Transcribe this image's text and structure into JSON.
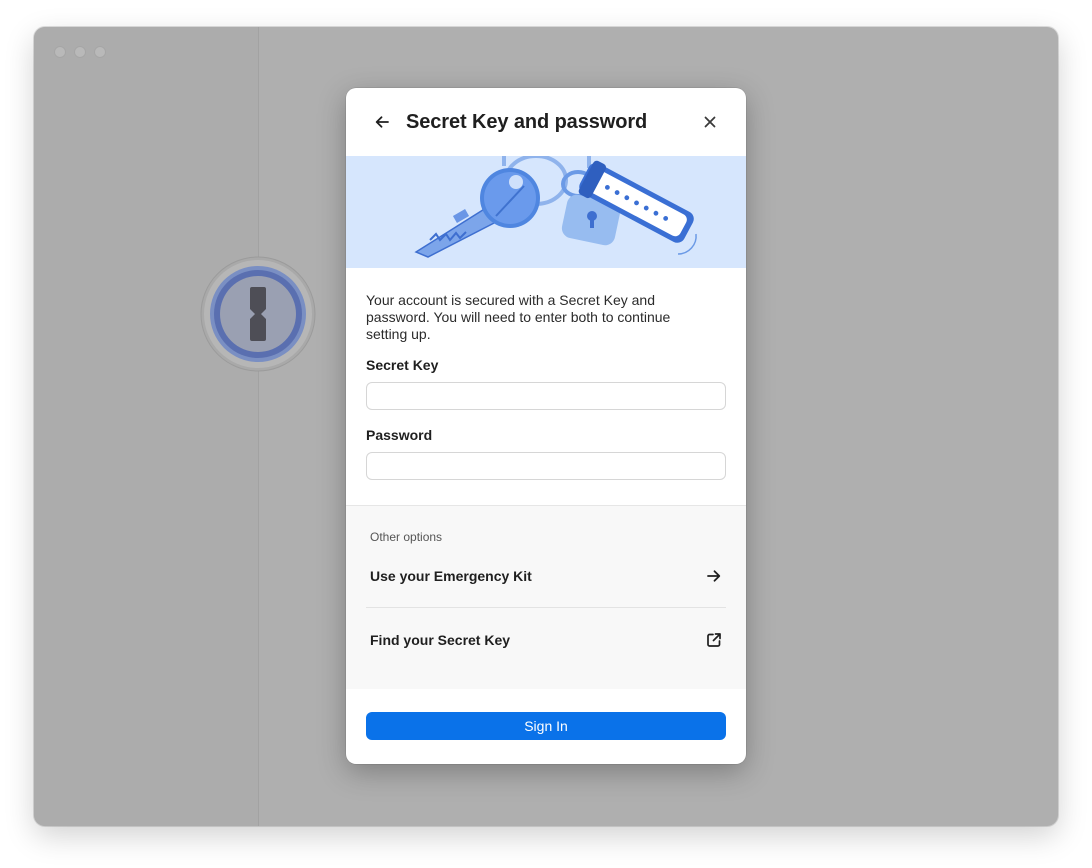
{
  "window": {
    "traffic_lights": [
      "close",
      "minimize",
      "zoom"
    ]
  },
  "app": {
    "logo_icon": "onepassword-keyhole-icon"
  },
  "dialog": {
    "title": "Secret Key and password",
    "back_icon": "arrow-left-icon",
    "close_icon": "close-icon",
    "illustration": "keys-and-lock-illustration",
    "description": "Your account is secured with a Secret Key and password. You will need to enter both to continue setting up.",
    "secret_key": {
      "label": "Secret Key",
      "value": "",
      "placeholder": ""
    },
    "password": {
      "label": "Password",
      "value": "",
      "placeholder": ""
    }
  },
  "other_options": {
    "heading": "Other options",
    "items": [
      {
        "label": "Use your Emergency Kit",
        "icon": "arrow-right-icon"
      },
      {
        "label": "Find your Secret Key",
        "icon": "external-link-icon"
      }
    ]
  },
  "footer": {
    "sign_in_label": "Sign In"
  },
  "colors": {
    "accent": "#0a72e9",
    "banner_bg": "#d6e6fd",
    "overlay": "#afafaf"
  }
}
